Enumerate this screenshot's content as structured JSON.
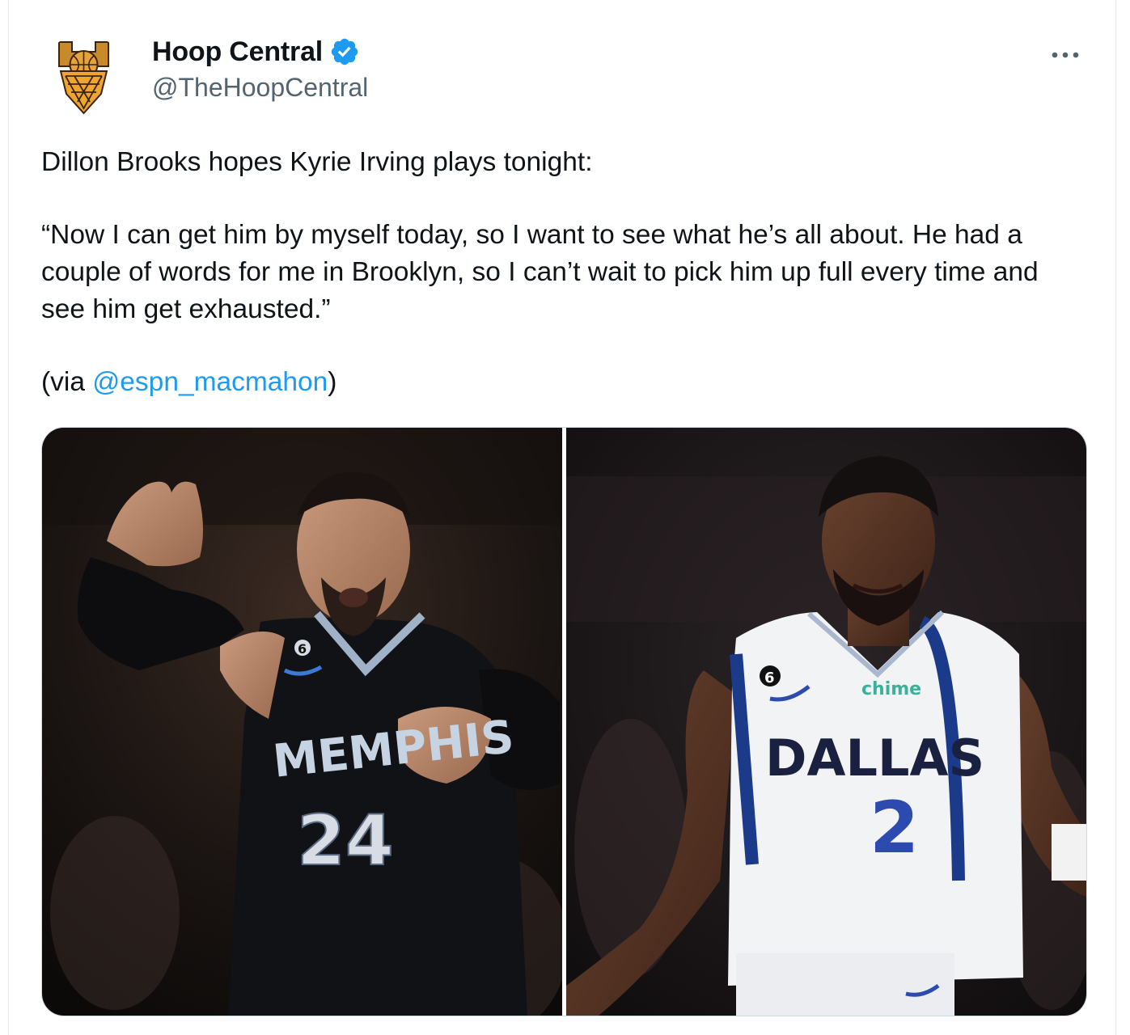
{
  "author": {
    "display_name": "Hoop Central",
    "handle": "@TheHoopCentral",
    "verified": true,
    "avatar_icon": "hoop-central-logo-icon",
    "verified_color": "#1d9bf0"
  },
  "tweet": {
    "line1": "Dillon Brooks hopes Kyrie Irving plays tonight:",
    "quote": "“Now I can get him by myself today, so I want to see what he’s all about. He had a couple of words for me in Brooklyn, so I can’t wait to pick him up full every time and see him get exhausted.”",
    "via_prefix": "(via ",
    "via_mention": "@espn_macmahon",
    "via_suffix": ")",
    "mention_color": "#1d9bf0"
  },
  "media": {
    "photo_left": {
      "jersey_text": "MEMPHIS",
      "jersey_number": "24",
      "patch_number": "6"
    },
    "photo_right": {
      "jersey_text": "DALLAS",
      "jersey_number": "2",
      "sponsor": "chime",
      "patch_number": "6"
    }
  },
  "actions": {
    "more_icon": "more-dots-icon"
  }
}
